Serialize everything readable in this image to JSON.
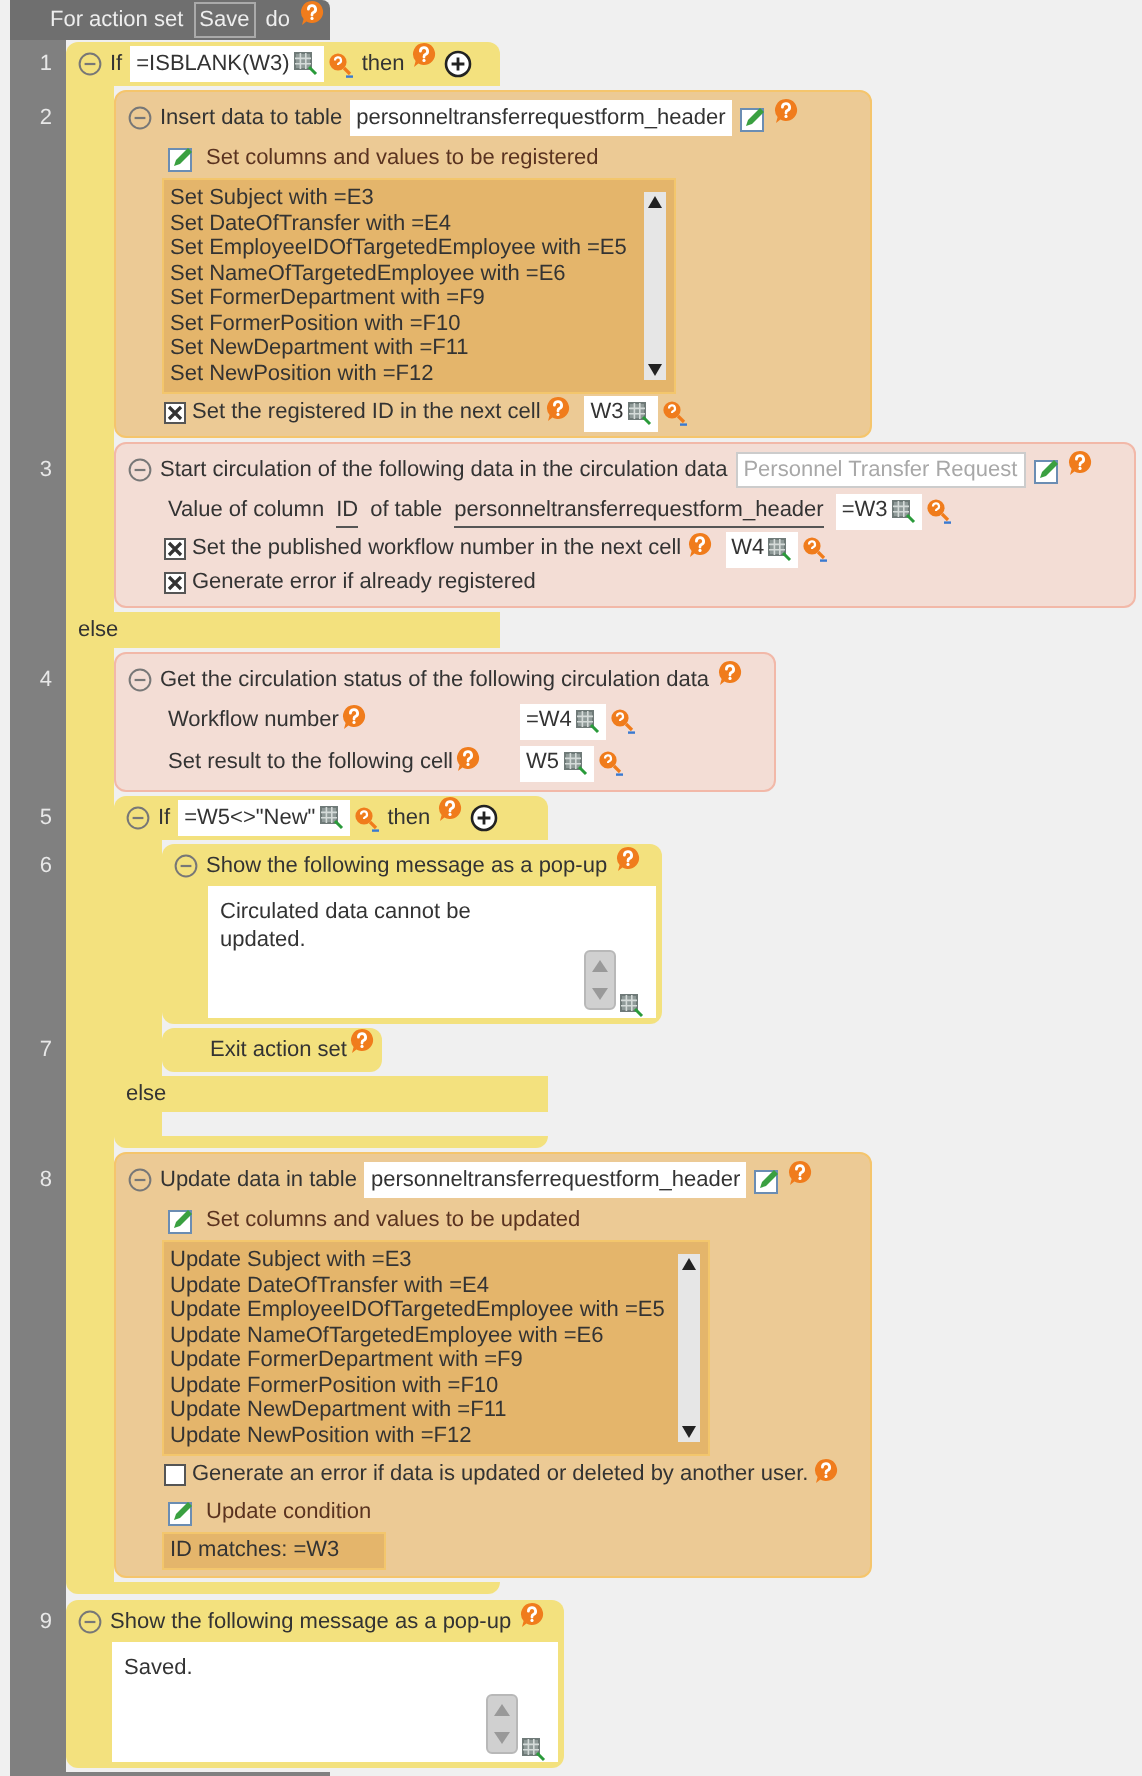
{
  "header": {
    "prefix": "For action set",
    "action_set": "Save",
    "suffix": "do"
  },
  "steps": [
    {
      "kind": "if",
      "number": "1",
      "keyword": "If",
      "condition": "=ISBLANK(W3)",
      "then": "then",
      "else": "else",
      "then_steps": [
        {
          "kind": "table_write",
          "number": "2",
          "title": "Insert data to table",
          "table": "personneltransferrequestform_header",
          "list_label": "Set columns and values to be registered",
          "assignments": [
            "Set Subject with =E3",
            "Set DateOfTransfer with =E4",
            "Set EmployeeIDOfTargetedEmployee with =E5",
            "Set NameOfTargetedEmployee with =E6",
            "Set FormerDepartment with =F9",
            "Set FormerPosition with =F10",
            "Set NewDepartment with =F11",
            "Set NewPosition with =F12"
          ],
          "options": [
            {
              "label": "Set the registered ID in the next cell",
              "checked": true,
              "help": true,
              "cell": "W3"
            }
          ]
        },
        {
          "kind": "circulation",
          "number": "3",
          "title": "Start circulation of the following data in the circulation data",
          "placeholder": "Personnel Transfer Request",
          "column_label": "Value of column",
          "column": "ID",
          "table_label": "of table",
          "table": "personneltransferrequestform_header",
          "value": "=W3",
          "options": [
            {
              "label": "Set the published workflow number in the next cell",
              "checked": true,
              "help": true,
              "cell": "W4"
            },
            {
              "label": "Generate error if already registered",
              "checked": true,
              "help": false
            }
          ]
        }
      ],
      "else_steps": [
        {
          "kind": "status",
          "number": "4",
          "title": "Get the circulation status of the following circulation data",
          "fields": [
            {
              "label": "Workflow number",
              "value": "=W4"
            },
            {
              "label": "Set result to the following cell",
              "value": "W5"
            }
          ]
        },
        {
          "kind": "if",
          "number": "5",
          "keyword": "If",
          "condition": "=W5<>\"New\"",
          "then": "then",
          "else": "else",
          "then_steps": [
            {
              "kind": "popup",
              "number": "6",
              "title": "Show the following message as a pop-up",
              "message": "Circulated data cannot be updated."
            },
            {
              "kind": "exit",
              "number": "7",
              "title": "Exit action set"
            }
          ]
        },
        {
          "kind": "table_write",
          "number": "8",
          "title": "Update data in table",
          "table": "personneltransferrequestform_header",
          "list_label": "Set columns and values to be updated",
          "assignments": [
            "Update Subject with =E3",
            "Update DateOfTransfer with =E4",
            "Update EmployeeIDOfTargetedEmployee with =E5",
            "Update NameOfTargetedEmployee with =E6",
            "Update FormerDepartment with =F9",
            "Update FormerPosition with =F10",
            "Update NewDepartment with =F11",
            "Update NewPosition with =F12"
          ],
          "options": [
            {
              "label": "Generate an error if data is updated or deleted by another user.",
              "checked": false,
              "help": true
            }
          ],
          "condition_label": "Update condition",
          "condition": "ID matches: =W3"
        }
      ]
    },
    {
      "kind": "popup",
      "number": "9",
      "title": "Show the following message as a pop-up",
      "message": "Saved."
    }
  ]
}
